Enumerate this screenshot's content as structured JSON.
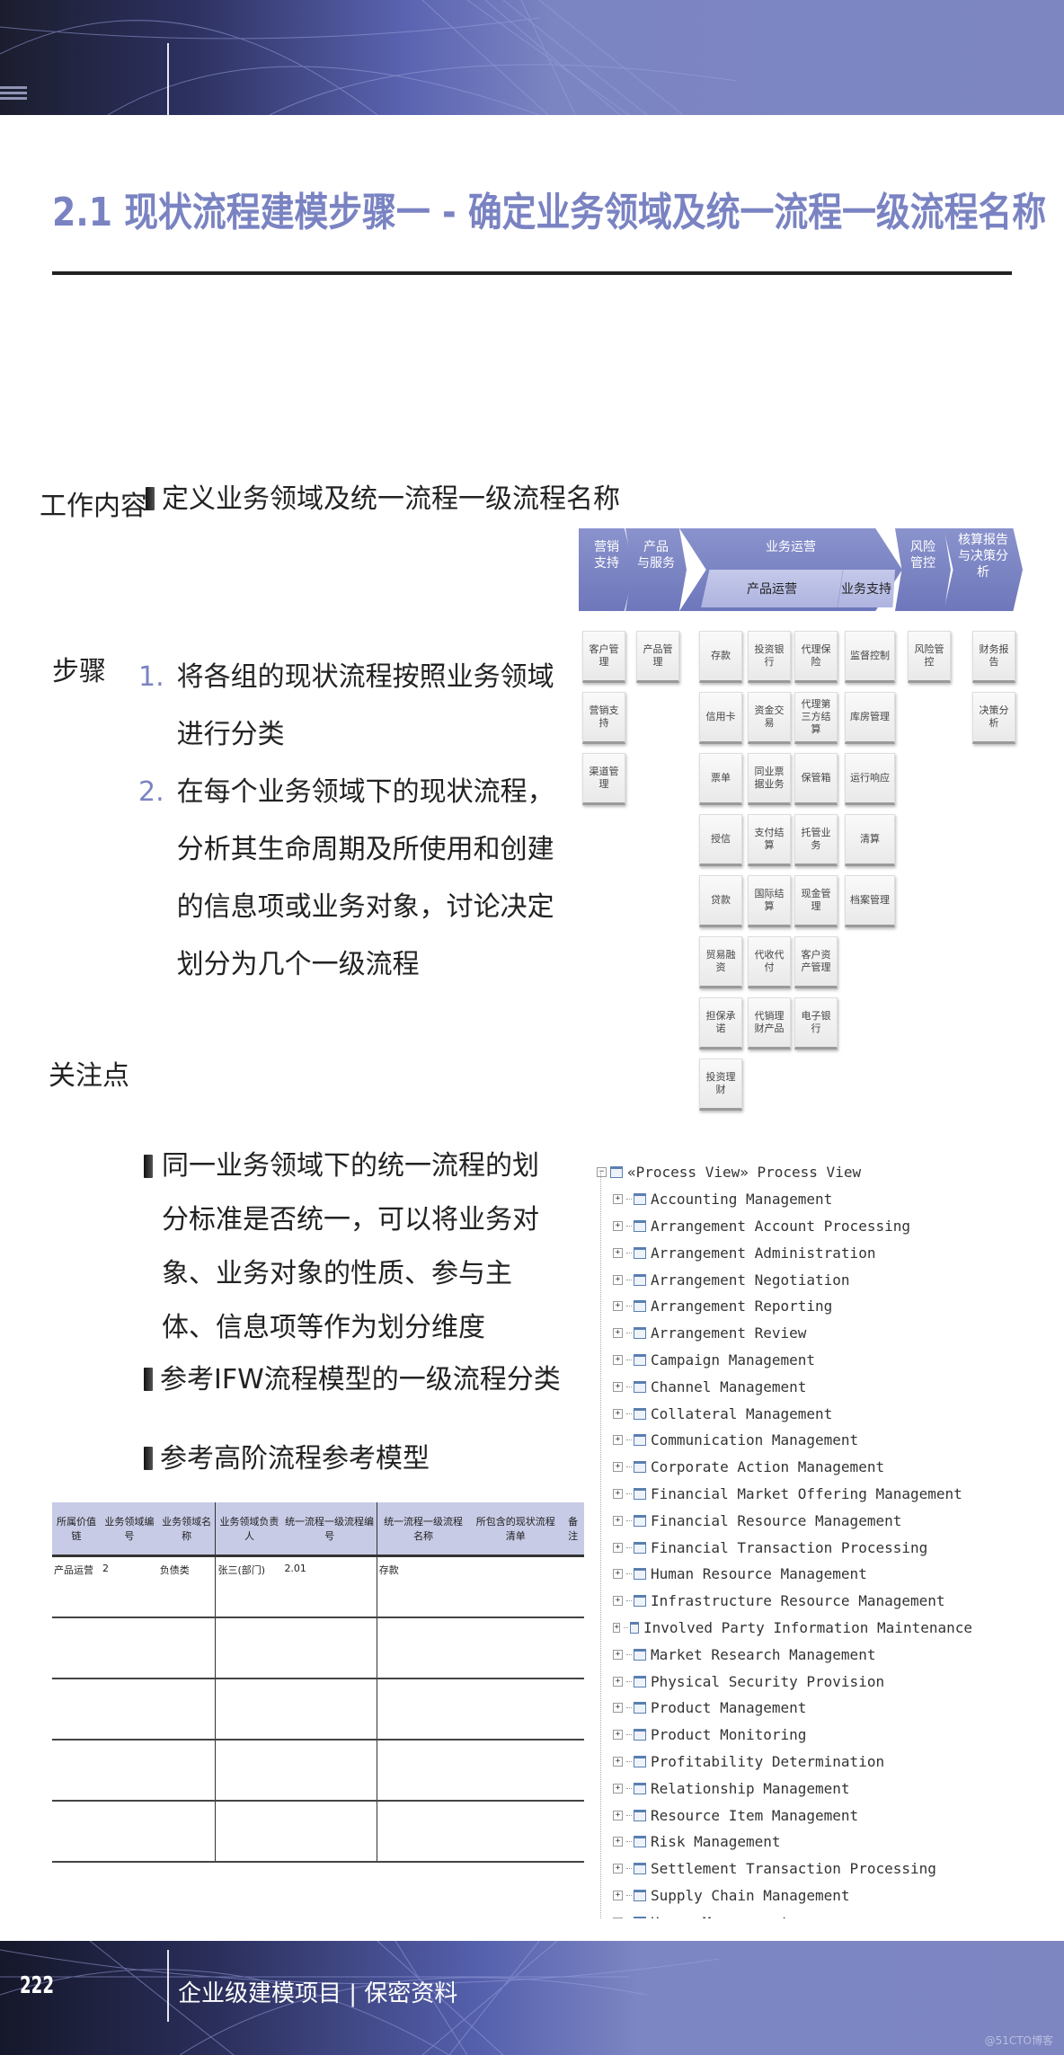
{
  "title": "2.1 现状流程建模步骤一 - 确定业务领域及统一流程一级流程名称",
  "work_content": {
    "label": "工作内容",
    "text": "定义业务领域及统一流程一级流程名称"
  },
  "steps": {
    "label": "步骤",
    "items": [
      {
        "num": "1.",
        "text": "将各组的现状流程按照业务领域进行分类"
      },
      {
        "num": "2.",
        "text": "在每个业务领域下的现状流程，分析其生命周期及所使用和创建的信息项或业务对象，讨论决定划分为几个一级流程"
      }
    ]
  },
  "focus": {
    "label": "关注点",
    "items": [
      "同一业务领域下的统一流程的划分标准是否统一，可以将业务对象、业务对象的性质、参与主体、信息项等作为划分维度",
      "参考IFW流程模型的一级流程分类",
      "参考高阶流程参考模型"
    ]
  },
  "value_chain": {
    "stages": [
      "营销\n支持",
      "产品\n与服务",
      "业务运营",
      "风险\n管控",
      "核算报告\n与决策分\n析"
    ],
    "sub_stages": [
      "产品运营",
      "业务支持"
    ],
    "columns": [
      {
        "stage": "营销支持",
        "boxes": [
          "客户管理",
          "营销支持",
          "渠道管理"
        ]
      },
      {
        "stage": "产品与服务",
        "boxes": [
          "产品管理"
        ]
      },
      {
        "stage": "产品运营-1",
        "boxes": [
          "存款",
          "信用卡",
          "票单",
          "授信",
          "贷款",
          "贸易融资",
          "担保承诺",
          "投资理财"
        ]
      },
      {
        "stage": "产品运营-2",
        "boxes": [
          "投资银行",
          "资金交易",
          "同业票据业务",
          "支付结算",
          "国际结算",
          "代收代付",
          "代销理财产品"
        ]
      },
      {
        "stage": "产品运营-3",
        "boxes": [
          "代理保险",
          "代理第三方结算",
          "保管箱",
          "托管业务",
          "现金管理",
          "客户资产管理",
          "电子银行"
        ]
      },
      {
        "stage": "业务支持",
        "boxes": [
          "监督控制",
          "库房管理",
          "运行响应",
          "清算",
          "档案管理"
        ]
      },
      {
        "stage": "风险管控",
        "boxes": [
          "风险管控"
        ]
      },
      {
        "stage": "核算报告与决策分析",
        "boxes": [
          "财务报告",
          "决策分析"
        ]
      }
    ]
  },
  "template_table": {
    "headers": [
      "所属价值链",
      "业务领域编号",
      "业务领域名称",
      "业务领域负责人",
      "统一流程一级流程编号",
      "统一流程一级流程名称",
      "所包含的现状流程清单",
      "备注"
    ],
    "rows": [
      [
        "产品运营",
        "2",
        "负债类",
        "张三(部门)",
        "2.01",
        "存款",
        "",
        ""
      ],
      [
        "",
        "",
        "",
        "",
        "",
        "",
        "",
        ""
      ],
      [
        "",
        "",
        "",
        "",
        "",
        "",
        "",
        ""
      ],
      [
        "",
        "",
        "",
        "",
        "",
        "",
        "",
        ""
      ],
      [
        "",
        "",
        "",
        "",
        "",
        "",
        "",
        ""
      ]
    ]
  },
  "process_tree": {
    "root": "«Process View» Process View",
    "items": [
      "Accounting Management",
      "Arrangement Account Processing",
      "Arrangement Administration",
      "Arrangement Negotiation",
      "Arrangement Reporting",
      "Arrangement Review",
      "Campaign Management",
      "Channel Management",
      "Collateral Management",
      "Communication Management",
      "Corporate Action Management",
      "Financial Market Offering Management",
      "Financial Resource Management",
      "Financial Transaction Processing",
      "Human Resource Management",
      "Infrastructure Resource Management",
      "Involved Party Information Maintenance",
      "Market Research Management",
      "Physical Security Provision",
      "Product Management",
      "Product Monitoring",
      "Profitability Determination",
      "Relationship Management",
      "Resource Item Management",
      "Risk Management",
      "Settlement Transaction Processing",
      "Supply Chain Management",
      "Usage Management"
    ]
  },
  "footer": {
    "page_number": "222",
    "text": "企业级建模项目 | 保密资料",
    "watermark": "@51CTO博客"
  },
  "colors": {
    "accent": "#7a83c2",
    "banner": "#7d86c1",
    "table_header": "#c8cbe6"
  }
}
